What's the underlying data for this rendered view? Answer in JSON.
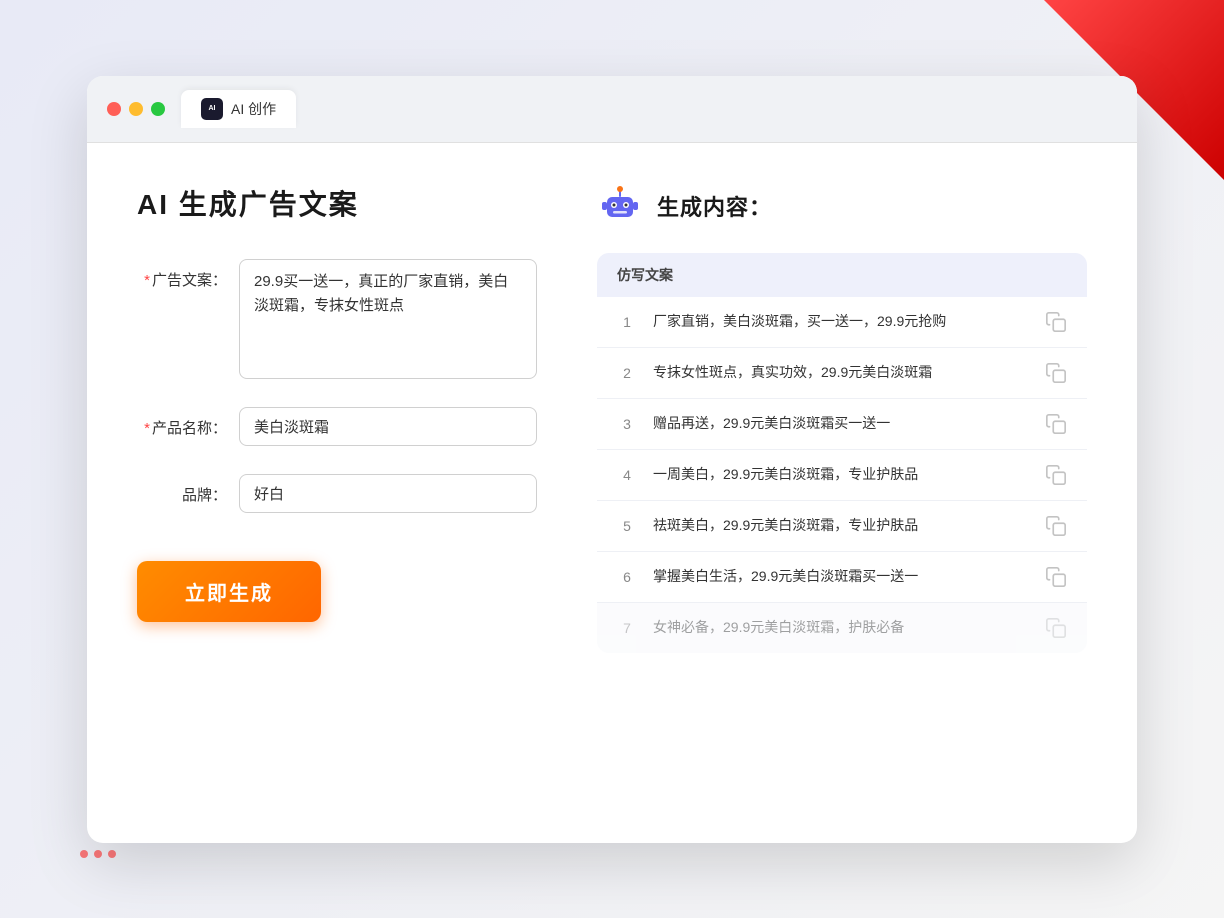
{
  "window": {
    "tab_label": "AI 创作",
    "tab_icon_text": "AI"
  },
  "left_panel": {
    "title": "AI 生成广告文案",
    "ad_copy_label": "广告文案：",
    "ad_copy_required": "*",
    "ad_copy_value": "29.9买一送一，真正的厂家直销，美白淡斑霜，专抹女性斑点",
    "product_name_label": "产品名称：",
    "product_name_required": "*",
    "product_name_value": "美白淡斑霜",
    "brand_label": "品牌：",
    "brand_value": "好白",
    "generate_btn_label": "立即生成"
  },
  "right_panel": {
    "title": "生成内容：",
    "results_header": "仿写文案",
    "results": [
      {
        "num": "1",
        "text": "厂家直销，美白淡斑霜，买一送一，29.9元抢购",
        "faded": false
      },
      {
        "num": "2",
        "text": "专抹女性斑点，真实功效，29.9元美白淡斑霜",
        "faded": false
      },
      {
        "num": "3",
        "text": "赠品再送，29.9元美白淡斑霜买一送一",
        "faded": false
      },
      {
        "num": "4",
        "text": "一周美白，29.9元美白淡斑霜，专业护肤品",
        "faded": false
      },
      {
        "num": "5",
        "text": "祛斑美白，29.9元美白淡斑霜，专业护肤品",
        "faded": false
      },
      {
        "num": "6",
        "text": "掌握美白生活，29.9元美白淡斑霜买一送一",
        "faded": false
      },
      {
        "num": "7",
        "text": "女神必备，29.9元美白淡斑霜，护肤必备",
        "faded": true
      }
    ]
  },
  "colors": {
    "accent_orange": "#ff6600",
    "accent_blue": "#5b6af0",
    "required_red": "#ff4444"
  }
}
